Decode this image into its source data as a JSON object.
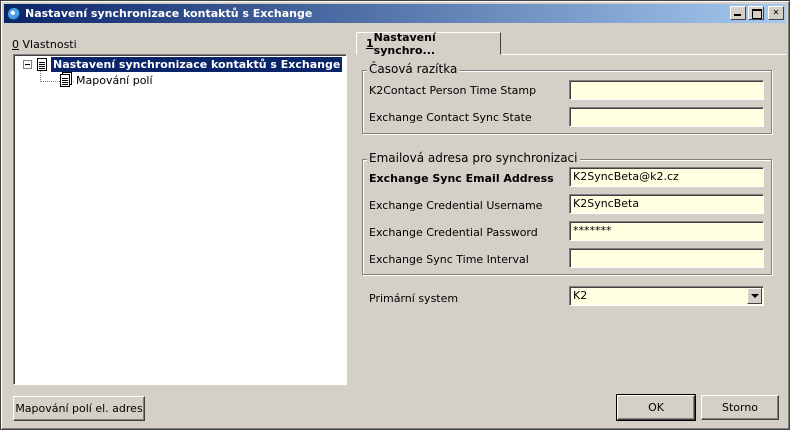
{
  "window": {
    "title": "Nastavení synchronizace kontaktů s Exchange"
  },
  "left_panel": {
    "label_prefix": "0",
    "label_rest": " Vlastnosti",
    "tree": [
      {
        "label": "Nastavení synchronizace kontaktů s Exchange",
        "selected": true
      },
      {
        "label": "Mapování polí",
        "selected": false
      }
    ]
  },
  "tab": {
    "prefix": "1",
    "label": " Nastavení synchro..."
  },
  "timestamps_group": {
    "title": "Časová razítka",
    "fields": [
      {
        "label": "K2Contact Person Time Stamp",
        "value": ""
      },
      {
        "label": "Exchange Contact Sync State",
        "value": ""
      }
    ]
  },
  "email_group": {
    "title": "Emailová adresa pro synchronizaci",
    "fields": [
      {
        "label": "Exchange Sync Email Address",
        "value": "K2SyncBeta@k2.cz"
      },
      {
        "label": "Exchange Credential Username",
        "value": "K2SyncBeta"
      },
      {
        "label": "Exchange Credential Password",
        "value": "*******"
      },
      {
        "label": "Exchange Sync Time Interval",
        "value": ""
      }
    ]
  },
  "primary_system": {
    "label": "Primární system",
    "value": "K2"
  },
  "buttons": {
    "field_mapping": "Mapování polí el. adres",
    "ok": "OK",
    "cancel": "Storno"
  }
}
